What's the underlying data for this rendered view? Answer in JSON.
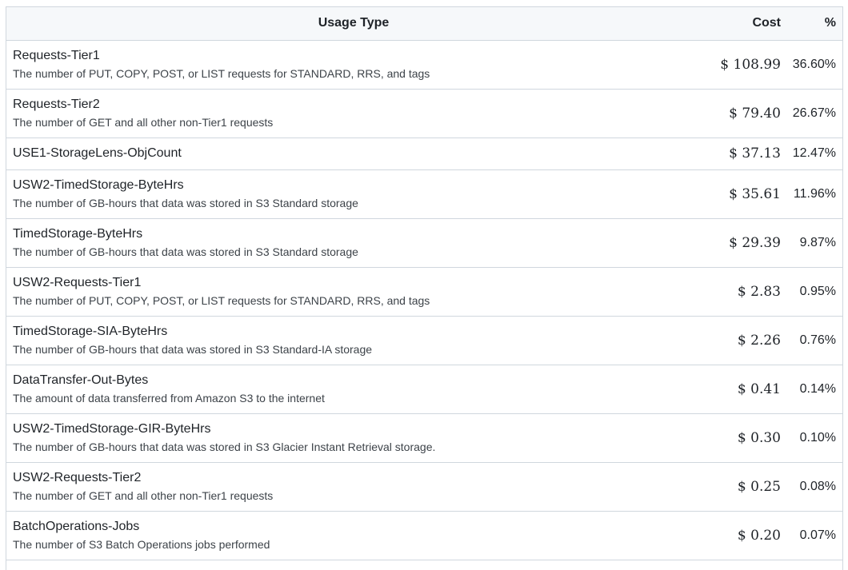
{
  "table": {
    "headers": {
      "usage": "Usage Type",
      "cost": "Cost",
      "pct": "%"
    },
    "rows": [
      {
        "name": "Requests-Tier1",
        "desc": "The number of PUT, COPY, POST, or LIST requests for STANDARD, RRS, and tags",
        "cost": "$ 108.99",
        "pct": "36.60%"
      },
      {
        "name": "Requests-Tier2",
        "desc": "The number of GET and all other non-Tier1 requests",
        "cost": "$ 79.40",
        "pct": "26.67%"
      },
      {
        "name": "USE1-StorageLens-ObjCount",
        "desc": "",
        "cost": "$ 37.13",
        "pct": "12.47%"
      },
      {
        "name": "USW2-TimedStorage-ByteHrs",
        "desc": "The number of GB-hours that data was stored in S3 Standard storage",
        "cost": "$ 35.61",
        "pct": "11.96%"
      },
      {
        "name": "TimedStorage-ByteHrs",
        "desc": "The number of GB-hours that data was stored in S3 Standard storage",
        "cost": "$ 29.39",
        "pct": "9.87%"
      },
      {
        "name": "USW2-Requests-Tier1",
        "desc": "The number of PUT, COPY, POST, or LIST requests for STANDARD, RRS, and tags",
        "cost": "$ 2.83",
        "pct": "0.95%"
      },
      {
        "name": "TimedStorage-SIA-ByteHrs",
        "desc": "The number of GB-hours that data was stored in S3 Standard-IA storage",
        "cost": "$ 2.26",
        "pct": "0.76%"
      },
      {
        "name": "DataTransfer-Out-Bytes",
        "desc": "The amount of data transferred from Amazon S3 to the internet",
        "cost": "$ 0.41",
        "pct": "0.14%"
      },
      {
        "name": "USW2-TimedStorage-GIR-ByteHrs",
        "desc": "The number of GB-hours that data was stored in S3 Glacier Instant Retrieval storage.",
        "cost": "$ 0.30",
        "pct": "0.10%"
      },
      {
        "name": "USW2-Requests-Tier2",
        "desc": "The number of GET and all other non-Tier1 requests",
        "cost": "$ 0.25",
        "pct": "0.08%"
      },
      {
        "name": "BatchOperations-Jobs",
        "desc": "The number of S3 Batch Operations jobs performed",
        "cost": "$ 0.20",
        "pct": "0.07%"
      }
    ]
  }
}
